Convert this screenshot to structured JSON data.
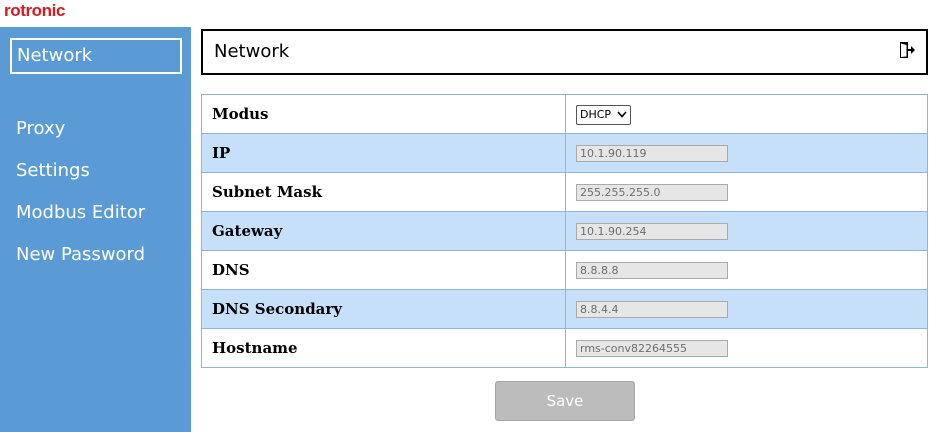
{
  "brand": {
    "logo_text": "rotronic",
    "logo_color": "#d71920"
  },
  "sidebar": {
    "background": "#5b9bd5",
    "items": [
      {
        "label": "Network",
        "active": true
      },
      {
        "label": "Proxy"
      },
      {
        "label": "Settings"
      },
      {
        "label": "Modbus Editor"
      },
      {
        "label": "New Password"
      }
    ]
  },
  "header": {
    "title": "Network",
    "logout_icon": "logout-icon"
  },
  "form": {
    "modus": {
      "label": "Modus",
      "value": "DHCP"
    },
    "ip": {
      "label": "IP",
      "value": "10.1.90.119"
    },
    "subnet": {
      "label": "Subnet Mask",
      "value": "255.255.255.0"
    },
    "gateway": {
      "label": "Gateway",
      "value": "10.1.90.254"
    },
    "dns": {
      "label": "DNS",
      "value": "8.8.8.8"
    },
    "dns2": {
      "label": "DNS Secondary",
      "value": "8.8.4.4"
    },
    "hostname": {
      "label": "Hostname",
      "value": "rms-conv82264555"
    }
  },
  "actions": {
    "save_label": "Save"
  }
}
